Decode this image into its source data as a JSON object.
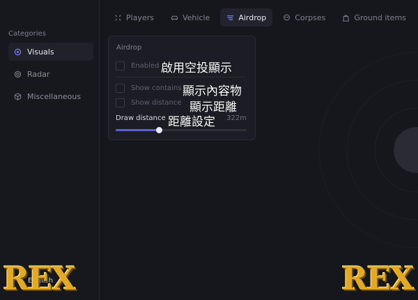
{
  "sidebar": {
    "section_title": "Categories",
    "items": [
      {
        "label": "Visuals",
        "icon": "eye-icon",
        "active": true
      },
      {
        "label": "Radar",
        "icon": "radar-icon",
        "active": false
      },
      {
        "label": "Miscellaneous",
        "icon": "cube-icon",
        "active": false
      }
    ],
    "language": "English"
  },
  "tabs": [
    {
      "label": "Players",
      "icon": "crosshair-icon",
      "active": false
    },
    {
      "label": "Vehicle",
      "icon": "car-icon",
      "active": false
    },
    {
      "label": "Airdrop",
      "icon": "airdrop-icon",
      "active": true
    },
    {
      "label": "Corpses",
      "icon": "skull-icon",
      "active": false
    },
    {
      "label": "Ground items",
      "icon": "bag-icon",
      "active": false
    }
  ],
  "panel": {
    "title": "Airdrop",
    "enabled_label": "Enabled",
    "enabled_annotation": "啟用空投顯示",
    "show_contains_label": "Show contains",
    "show_contains_annotation": "顯示內容物",
    "show_distance_label": "Show distance",
    "show_distance_annotation": "顯示距離",
    "draw_distance_label": "Draw distance",
    "draw_distance_annotation": "距離設定",
    "draw_distance_value": "322m",
    "draw_distance_fraction": 0.33
  },
  "watermark": {
    "text": "REX"
  },
  "colors": {
    "accent": "#5b60d6",
    "logo_gold": "#e3a825",
    "background": "#16171d"
  }
}
